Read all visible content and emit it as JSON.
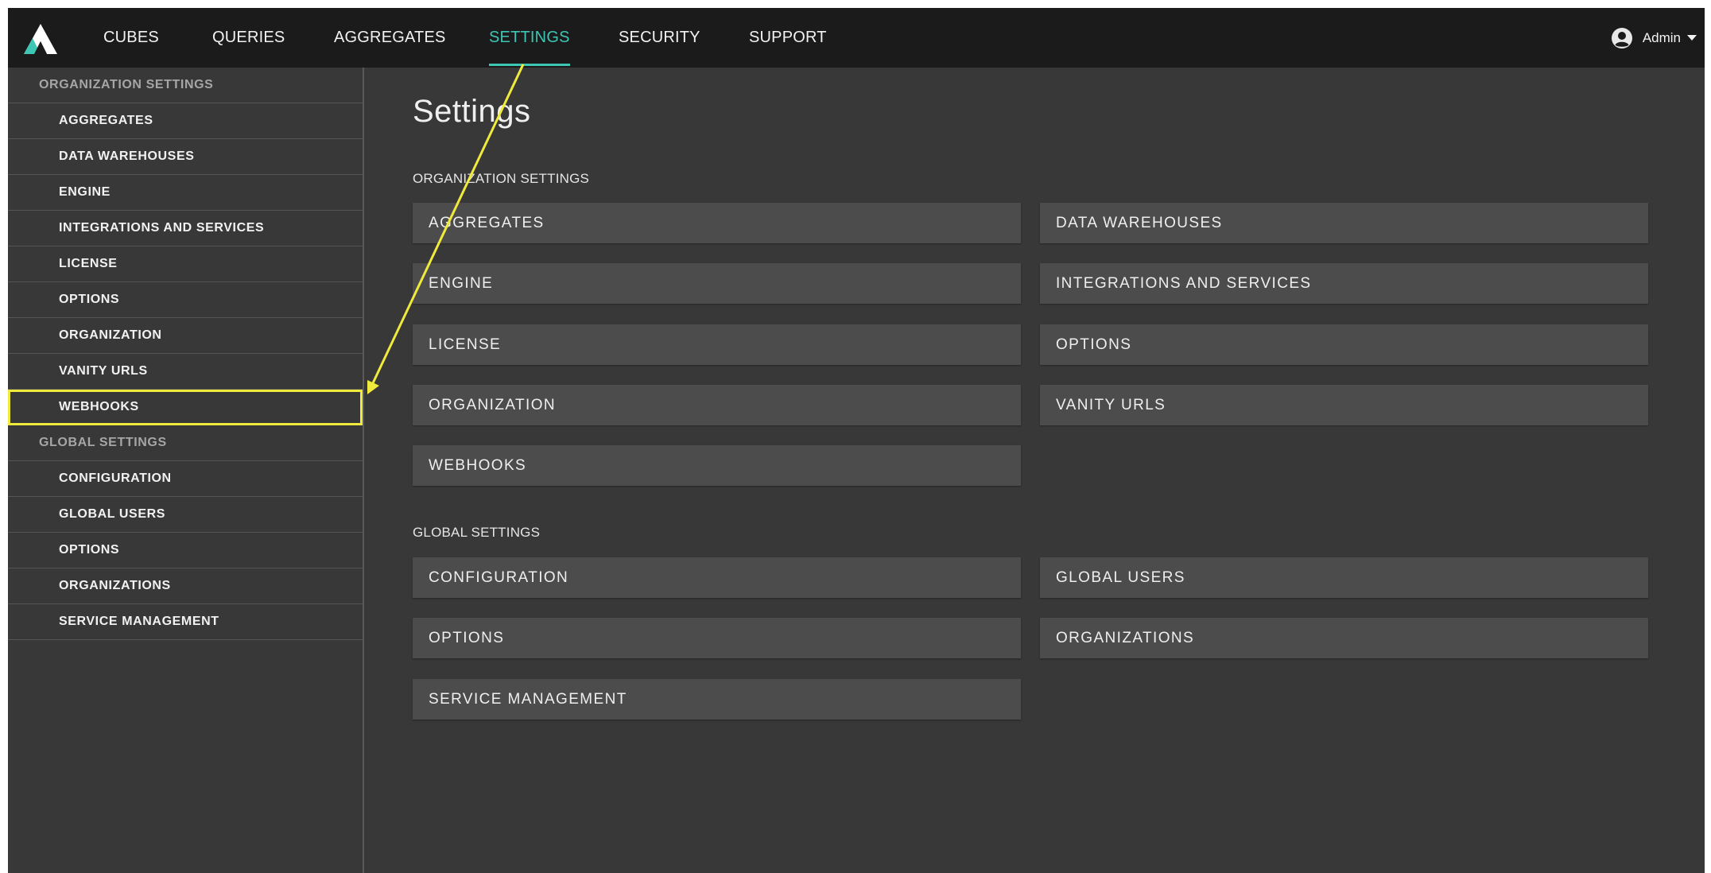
{
  "nav": {
    "items": [
      {
        "label": "CUBES"
      },
      {
        "label": "QUERIES"
      },
      {
        "label": "AGGREGATES"
      },
      {
        "label": "SETTINGS"
      },
      {
        "label": "SECURITY"
      },
      {
        "label": "SUPPORT"
      }
    ],
    "active": "SETTINGS",
    "user_label": "Admin"
  },
  "sidebar": {
    "org_header": "ORGANIZATION SETTINGS",
    "org_items": [
      {
        "label": "AGGREGATES"
      },
      {
        "label": "DATA WAREHOUSES"
      },
      {
        "label": "ENGINE"
      },
      {
        "label": "INTEGRATIONS AND SERVICES"
      },
      {
        "label": "LICENSE"
      },
      {
        "label": "OPTIONS"
      },
      {
        "label": "ORGANIZATION"
      },
      {
        "label": "VANITY URLS"
      },
      {
        "label": "WEBHOOKS"
      }
    ],
    "global_header": "GLOBAL SETTINGS",
    "global_items": [
      {
        "label": "CONFIGURATION"
      },
      {
        "label": "GLOBAL USERS"
      },
      {
        "label": "OPTIONS"
      },
      {
        "label": "ORGANIZATIONS"
      },
      {
        "label": "SERVICE MANAGEMENT"
      }
    ]
  },
  "main": {
    "title": "Settings",
    "org_section_label": "ORGANIZATION SETTINGS",
    "org_cards": [
      {
        "label": "AGGREGATES"
      },
      {
        "label": "DATA WAREHOUSES"
      },
      {
        "label": "ENGINE"
      },
      {
        "label": "INTEGRATIONS AND SERVICES"
      },
      {
        "label": "LICENSE"
      },
      {
        "label": "OPTIONS"
      },
      {
        "label": "ORGANIZATION"
      },
      {
        "label": "VANITY URLS"
      },
      {
        "label": "WEBHOOKS"
      }
    ],
    "global_section_label": "GLOBAL SETTINGS",
    "global_cards": [
      {
        "label": "CONFIGURATION"
      },
      {
        "label": "GLOBAL USERS"
      },
      {
        "label": "OPTIONS"
      },
      {
        "label": "ORGANIZATIONS"
      },
      {
        "label": "SERVICE MANAGEMENT"
      }
    ]
  },
  "colors": {
    "accent": "#3ec6b4",
    "annotation": "#f0ea3c",
    "nav_bg": "#1b1b1b",
    "page_bg": "#383838",
    "card_bg": "#4c4c4c"
  },
  "icons": {
    "logo": "atscale-logo-icon",
    "user": "user-circle-icon",
    "caret": "caret-down-icon"
  }
}
